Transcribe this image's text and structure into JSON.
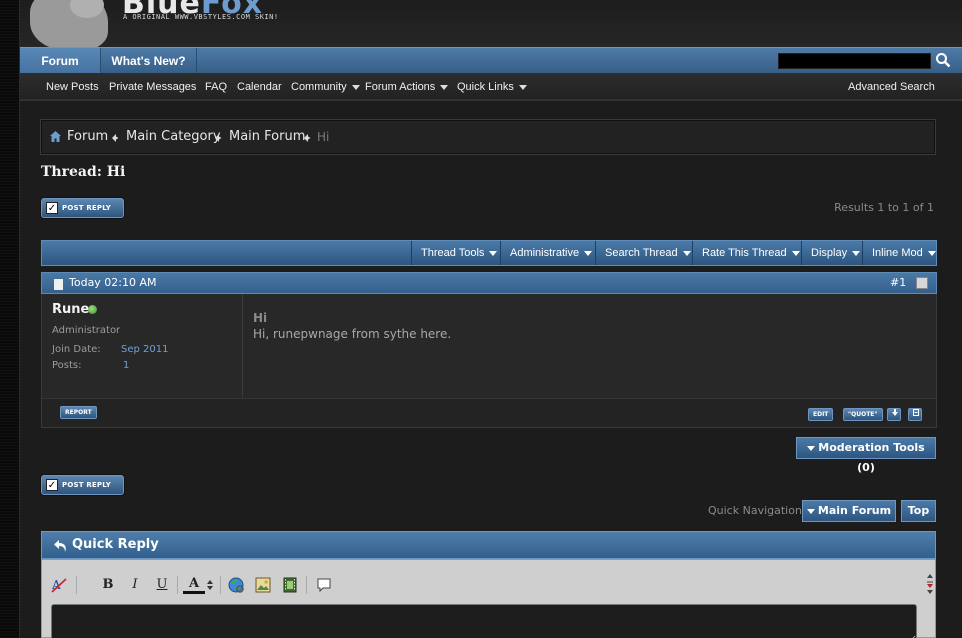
{
  "header": {
    "logo_title_a": "Blue",
    "logo_title_b": "Fox",
    "logo_subtitle": "A ORIGINAL WWW.VBSTYLES.COM SKIN!"
  },
  "navbar": {
    "tabs": [
      {
        "label": "Forum",
        "active": true
      },
      {
        "label": "What's New?",
        "active": false
      }
    ],
    "search": {
      "value": "",
      "placeholder": ""
    }
  },
  "subnav": {
    "links": [
      {
        "label": "New Posts",
        "dropdown": false
      },
      {
        "label": "Private Messages",
        "dropdown": false
      },
      {
        "label": "FAQ",
        "dropdown": false
      },
      {
        "label": "Calendar",
        "dropdown": false
      },
      {
        "label": "Community",
        "dropdown": true
      },
      {
        "label": "Forum Actions",
        "dropdown": true
      },
      {
        "label": "Quick Links",
        "dropdown": true
      }
    ],
    "advanced_search": "Advanced Search"
  },
  "breadcrumb": [
    "Forum",
    "Main Category",
    "Main Forum",
    "Hi"
  ],
  "thread": {
    "title": "Thread: Hi",
    "post_reply_label": "POST REPLY",
    "results_text": "Results 1 to 1 of 1"
  },
  "toolbar": {
    "tools": [
      "Thread Tools",
      "Administrative",
      "Search Thread",
      "Rate This Thread",
      "Display",
      "Inline Mod"
    ]
  },
  "post": {
    "date": "Today 02:10 AM",
    "number": "#1",
    "username": "Rune",
    "user_title": "Administrator",
    "join_date_label": "Join Date:",
    "join_date_value": "Sep 2011",
    "posts_label": "Posts:",
    "posts_value": "1",
    "title": "Hi",
    "body": "Hi, runepwnage from sythe here.",
    "report_label": "REPORT",
    "edit_label": "EDIT",
    "quote_label": "\"QUOTE\""
  },
  "moderation_tools": "Moderation Tools (0)",
  "quick_nav": {
    "label": "Quick Navigation",
    "forum_button": "Main Forum",
    "top_button": "Top"
  },
  "quick_reply": {
    "title": "Quick Reply",
    "toolbar": {
      "bold": "B",
      "italic": "I",
      "underline": "U",
      "font_color": "A"
    },
    "message": ""
  },
  "colors": {
    "accent_blue": "#4a79a6",
    "link_blue": "#6fa0d6",
    "background": "#1c1c1c"
  }
}
